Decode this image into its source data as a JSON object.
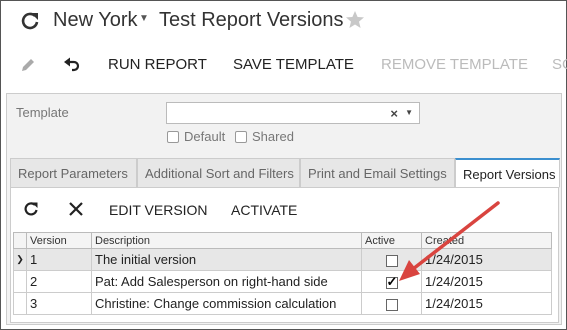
{
  "header": {
    "company": "New York",
    "title": "Test Report Versions"
  },
  "toolbar": {
    "run_report": "RUN REPORT",
    "save_template": "SAVE TEMPLATE",
    "remove_template": "REMOVE TEMPLATE",
    "overflow": "SC"
  },
  "form": {
    "template_label": "Template",
    "template_value": "",
    "default_label": "Default",
    "shared_label": "Shared"
  },
  "tabs": [
    {
      "label": "Report Parameters"
    },
    {
      "label": "Additional Sort and Filters"
    },
    {
      "label": "Print and Email Settings"
    },
    {
      "label": "Report Versions"
    }
  ],
  "grid": {
    "edit_version": "EDIT VERSION",
    "activate": "ACTIVATE",
    "columns": {
      "version": "Version",
      "description": "Description",
      "active": "Active",
      "created": "Created"
    },
    "rows": [
      {
        "version": "1",
        "description": "The initial version",
        "active": false,
        "created": "1/24/2015"
      },
      {
        "version": "2",
        "description": "Pat: Add Salesperson on right-hand side",
        "active": true,
        "created": "1/24/2015"
      },
      {
        "version": "3",
        "description": "Christine: Change commission calculation",
        "active": false,
        "created": "1/24/2015"
      }
    ]
  },
  "colors": {
    "arrow": "#d9443f",
    "active_tab_accent": "#3b8fcf"
  }
}
